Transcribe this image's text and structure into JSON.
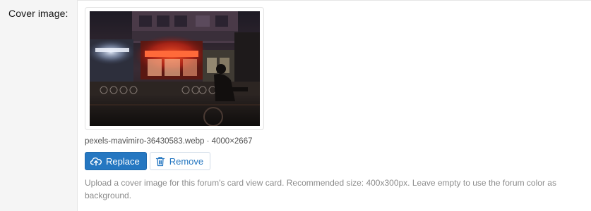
{
  "field": {
    "label": "Cover image:"
  },
  "image": {
    "filename_meta": "pexels-mavimiro-36430583.webp · 4000×2667"
  },
  "buttons": {
    "replace_label": "Replace",
    "remove_label": "Remove"
  },
  "help_text": "Upload a cover image for this forum's card view card. Recommended size: 400x300px. Leave empty to use the forum color as background.",
  "colors": {
    "primary": "#2577c1",
    "muted_text": "#8c8c8c"
  },
  "icons": {
    "replace": "upload-icon",
    "remove": "trash-icon"
  }
}
